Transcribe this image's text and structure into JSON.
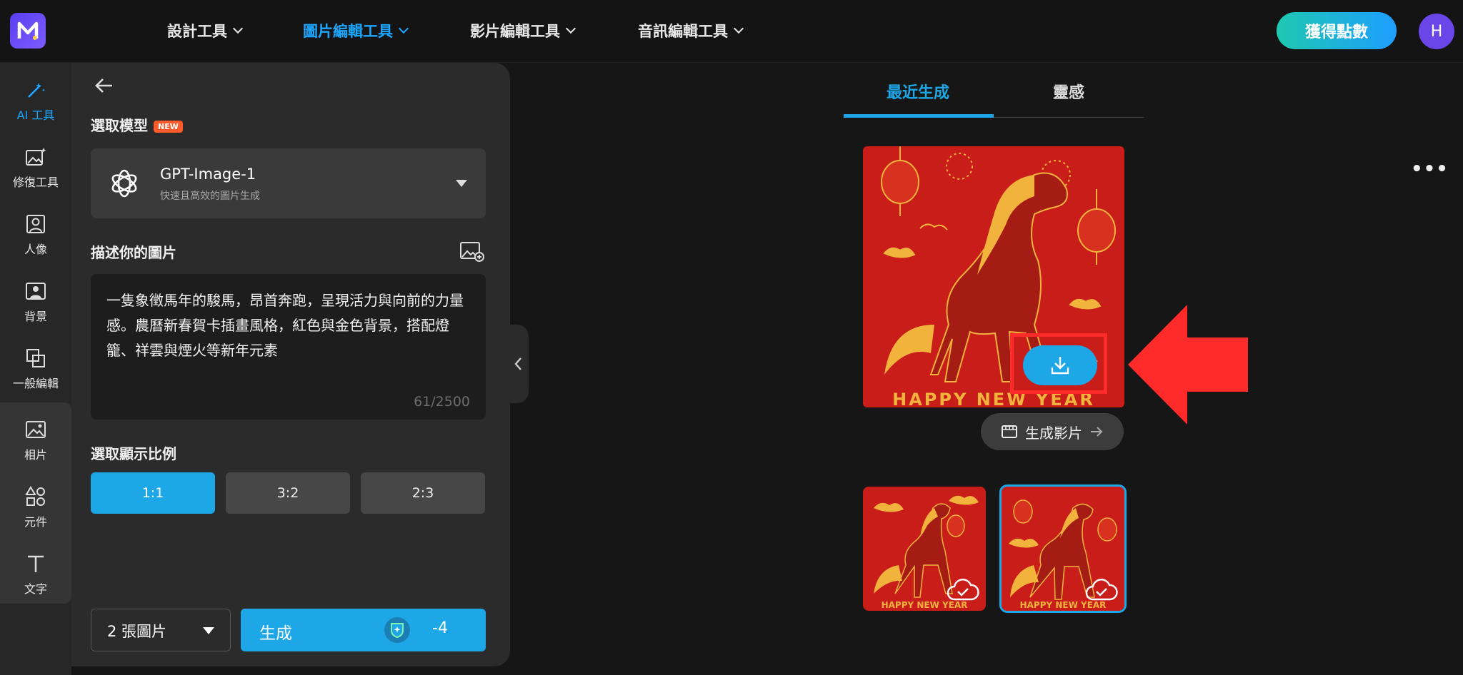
{
  "nav": {
    "items": [
      {
        "label": "設計工具"
      },
      {
        "label": "圖片編輯工具"
      },
      {
        "label": "影片編輯工具"
      },
      {
        "label": "音訊編輯工具"
      }
    ],
    "get_points_label": "獲得點數",
    "avatar_initial": "H"
  },
  "rail": {
    "items": [
      {
        "label": "AI 工具",
        "icon": "magic-wand-icon"
      },
      {
        "label": "修復工具",
        "icon": "image-sparkle-icon"
      },
      {
        "label": "人像",
        "icon": "portrait-icon"
      },
      {
        "label": "背景",
        "icon": "background-icon"
      },
      {
        "label": "一般編輯",
        "icon": "crop-icon"
      },
      {
        "label": "相片",
        "icon": "photo-icon"
      },
      {
        "label": "元件",
        "icon": "shapes-icon"
      },
      {
        "label": "文字",
        "icon": "text-icon"
      }
    ]
  },
  "panel": {
    "model_section_label": "選取模型",
    "new_badge": "NEW",
    "model_name": "GPT-Image-1",
    "model_desc": "快速且高效的圖片生成",
    "describe_label": "描述你的圖片",
    "prompt_text": "一隻象徵馬年的駿馬，昂首奔跑，呈現活力與向前的力量感。農曆新春賀卡插畫風格，紅色與金色背景，搭配燈籠、祥雲與煙火等新年元素",
    "char_count": "61/2500",
    "ratio_label": "選取顯示比例",
    "ratios": [
      "1:1",
      "3:2",
      "2:3"
    ],
    "selected_ratio": "1:1",
    "image_count": "2 張圖片",
    "generate_label": "生成",
    "credit_cost": "-4"
  },
  "results": {
    "tabs": [
      "最近生成",
      "靈感"
    ],
    "active_tab": "最近生成",
    "image_caption": "HAPPY NEW YEAR",
    "generate_video_label": "生成影片",
    "more_label": "•••"
  },
  "colors": {
    "accent": "#1ea7e6",
    "annotation_red": "#ff2b2b",
    "poster_red": "#c91d1a",
    "gold": "#f2b33d"
  }
}
